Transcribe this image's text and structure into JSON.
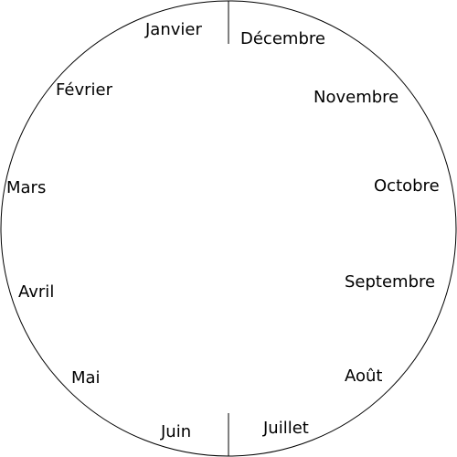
{
  "colors": {
    "background": "#ffffff",
    "stroke": "#000000",
    "text": "#000000"
  },
  "months": [
    "Janvier",
    "Décembre",
    "Février",
    "Novembre",
    "Mars",
    "Octobre",
    "Avril",
    "Septembre",
    "Mai",
    "Août",
    "Juin",
    "Juillet"
  ]
}
